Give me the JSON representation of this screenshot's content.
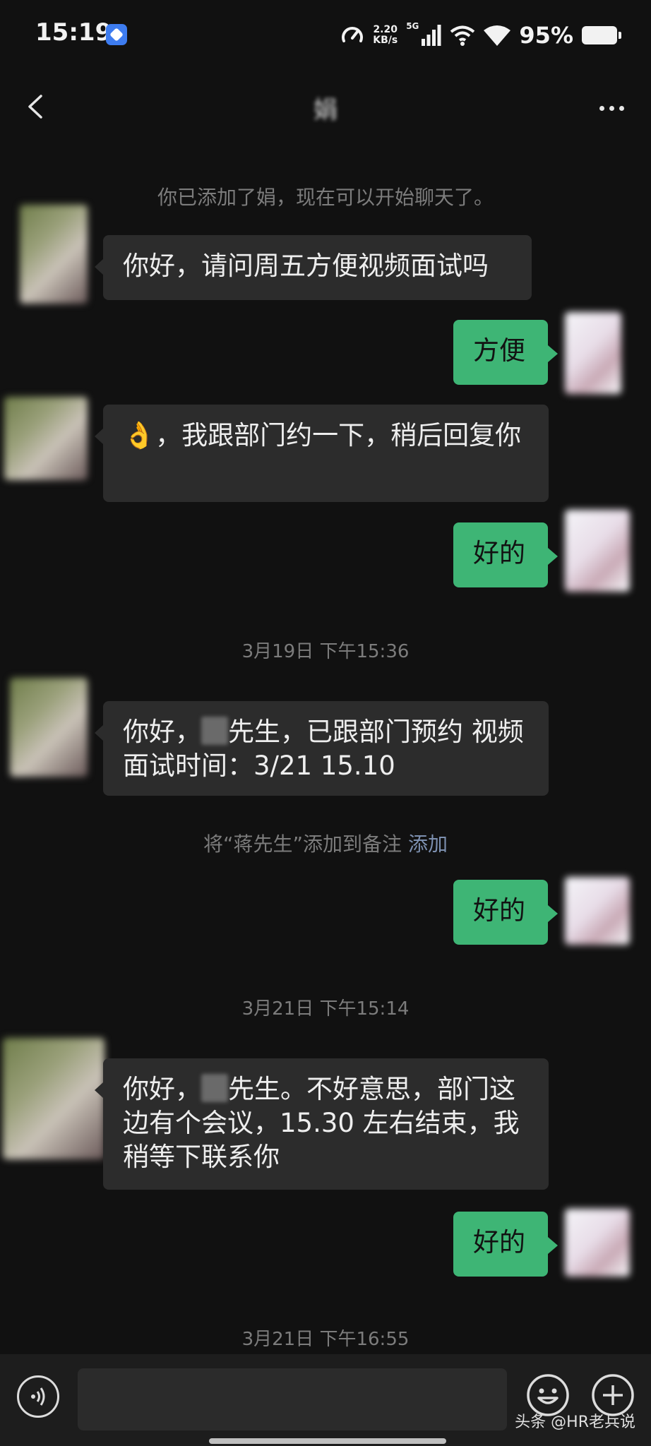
{
  "status_bar": {
    "time": "15:19",
    "net_speed_value": "2.20",
    "net_speed_unit": "KB/s",
    "network_type": "5G",
    "battery": "95%"
  },
  "header": {
    "title": "娟",
    "back_icon": "chevron-left-icon",
    "more_icon": "more-horizontal-icon"
  },
  "messages": [
    {
      "type": "system",
      "text": "你已添加了娟，现在可以开始聊天了。"
    },
    {
      "type": "in",
      "text": "你好，请问周五方便视频面试吗"
    },
    {
      "type": "out",
      "text": "方便"
    },
    {
      "type": "in",
      "emoji": "👌",
      "text": "，我跟部门约一下，稍后回复你"
    },
    {
      "type": "out",
      "text": "好的"
    },
    {
      "type": "time",
      "text": "3月19日 下午15:36"
    },
    {
      "type": "in",
      "text_a": "你好，",
      "text_b": "先生，已跟部门预约 视频面试时间：3/21  15.10"
    },
    {
      "type": "system",
      "text": "将“蒋先生”添加到备注",
      "link": "添加"
    },
    {
      "type": "out",
      "text": "好的"
    },
    {
      "type": "time",
      "text": "3月21日 下午15:14"
    },
    {
      "type": "in",
      "text_a": "你好，",
      "text_b": "先生。不好意思，部门这边有个会议，15.30 左右结束，我稍等下联系你"
    },
    {
      "type": "out",
      "text": "好的"
    },
    {
      "type": "time",
      "text": "3月21日 下午16:55"
    }
  ],
  "input_bar": {
    "voice_icon": "voice-icon",
    "emoji_icon": "emoji-icon",
    "plus_icon": "plus-icon",
    "input_value": ""
  },
  "watermark": "头条 @HR老兵说",
  "colors": {
    "background": "#111111",
    "incoming_bubble": "#2c2c2c",
    "outgoing_bubble": "#3eb575",
    "system_text": "#7c7c7c",
    "link": "#7d90b0"
  }
}
